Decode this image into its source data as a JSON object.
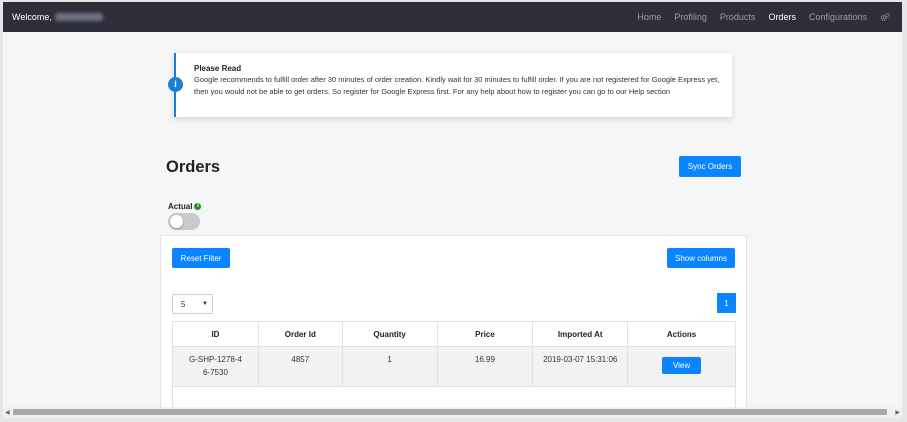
{
  "navbar": {
    "welcome": "Welcome,",
    "links": [
      {
        "label": "Home",
        "active": false
      },
      {
        "label": "Profiling",
        "active": false
      },
      {
        "label": "Products",
        "active": false
      },
      {
        "label": "Orders",
        "active": true
      },
      {
        "label": "Configurations",
        "active": false
      }
    ],
    "settings_icon": "gears-icon"
  },
  "alert": {
    "icon": "info-icon",
    "title": "Please Read",
    "body": "Google recommends to fulfill order after 30 minutes of order creation. Kindly wait for 30 minutes to fulfill order. If you are not registered for Google Express yet, then you would not be able to get orders. So register for Google Express first. For any help about how to register you can go to our Help section"
  },
  "page": {
    "title": "Orders",
    "sync_button": "Sync Orders",
    "actual_label": "Actual",
    "actual_enabled": false
  },
  "toolbar": {
    "reset_filter": "Reset Filter",
    "show_columns": "Show columns",
    "page_size": "5",
    "current_page": "1"
  },
  "table": {
    "headers": [
      "ID",
      "Order Id",
      "Quantity",
      "Price",
      "Imported At",
      "Actions"
    ],
    "rows": [
      {
        "id": "G-SHP-1278-46-7530",
        "order_id": "4857",
        "quantity": "1",
        "price": "16.99",
        "imported_at": "2019-03-07 15:31:06",
        "action": "View"
      }
    ]
  },
  "colors": {
    "navbar_bg": "#2e2f3a",
    "primary": "#0a84ff",
    "alert_accent": "#1b7fd6"
  }
}
